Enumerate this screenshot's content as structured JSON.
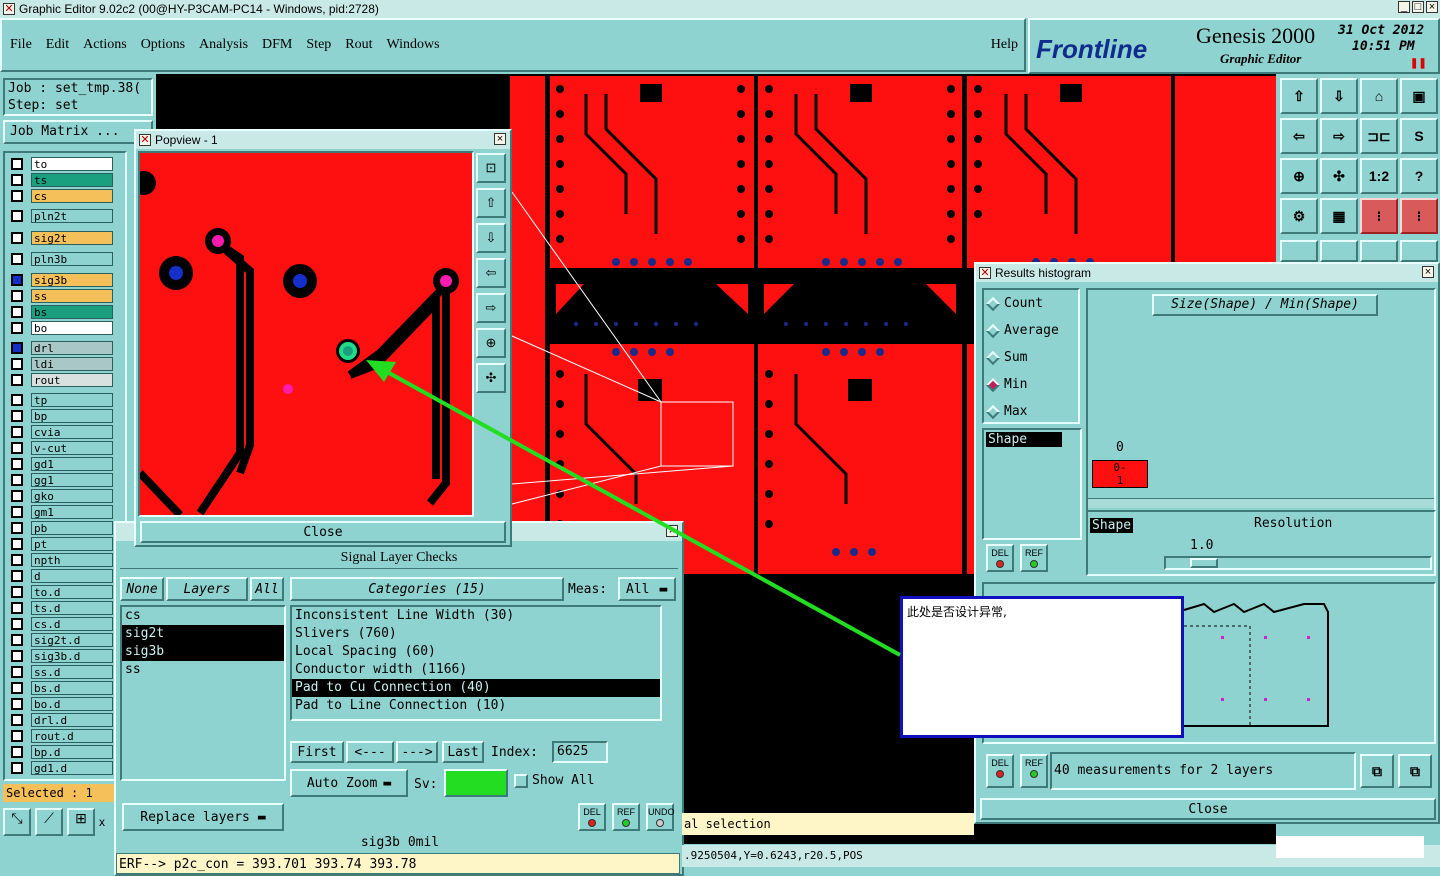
{
  "window": {
    "title": "Graphic Editor 9.02c2 (00@HY-P3CAM-PC14 - Windows, pid:2728)"
  },
  "menu": [
    "File",
    "Edit",
    "Actions",
    "Options",
    "Analysis",
    "DFM",
    "Step",
    "Rout",
    "Windows"
  ],
  "help": "Help",
  "brand": {
    "logo": "Frontline",
    "product": "Genesis 2000",
    "sub": "Graphic Editor",
    "date": "31 Oct 2012",
    "time": "10:51 PM"
  },
  "job": {
    "job": "Job : set_tmp.38(",
    "step": "Step: set",
    "matrix_btn": "Job Matrix ..."
  },
  "layers": [
    {
      "name": "to",
      "color": "#ffffff"
    },
    {
      "name": "ts",
      "color": "#1aa07f"
    },
    {
      "name": "cs",
      "color": "#f5c05a"
    },
    {
      "name": "pln2t",
      "color": "#8fd3d0"
    },
    {
      "name": "sig2t",
      "color": "#f5c05a"
    },
    {
      "name": "pln3b",
      "color": "#8fd3d0"
    },
    {
      "name": "sig3b",
      "color": "#f5c05a"
    },
    {
      "name": "ss",
      "color": "#f5c05a"
    },
    {
      "name": "bs",
      "color": "#1aa07f"
    },
    {
      "name": "bo",
      "color": "#ffffff"
    },
    {
      "name": "drl",
      "color": "#a9c7c6"
    },
    {
      "name": "ldi",
      "color": "#a9c7c6"
    },
    {
      "name": "rout",
      "color": "#d8e0e0"
    },
    {
      "name": "tp",
      "color": "#8fd3d0"
    },
    {
      "name": "bp",
      "color": "#8fd3d0"
    },
    {
      "name": "cvia",
      "color": "#8fd3d0"
    },
    {
      "name": "v-cut",
      "color": "#8fd3d0"
    },
    {
      "name": "gd1",
      "color": "#8fd3d0"
    },
    {
      "name": "gg1",
      "color": "#8fd3d0"
    },
    {
      "name": "gko",
      "color": "#8fd3d0"
    },
    {
      "name": "gm1",
      "color": "#8fd3d0"
    },
    {
      "name": "pb",
      "color": "#8fd3d0"
    },
    {
      "name": "pt",
      "color": "#8fd3d0"
    },
    {
      "name": "npth",
      "color": "#8fd3d0"
    },
    {
      "name": "d",
      "color": "#8fd3d0"
    },
    {
      "name": "to.d",
      "color": "#8fd3d0"
    },
    {
      "name": "ts.d",
      "color": "#8fd3d0"
    },
    {
      "name": "cs.d",
      "color": "#8fd3d0"
    },
    {
      "name": "sig2t.d",
      "color": "#8fd3d0"
    },
    {
      "name": "sig3b.d",
      "color": "#8fd3d0"
    },
    {
      "name": "ss.d",
      "color": "#8fd3d0"
    },
    {
      "name": "bs.d",
      "color": "#8fd3d0"
    },
    {
      "name": "bo.d",
      "color": "#8fd3d0"
    },
    {
      "name": "drl.d",
      "color": "#8fd3d0"
    },
    {
      "name": "rout.d",
      "color": "#8fd3d0"
    },
    {
      "name": "bp.d",
      "color": "#8fd3d0"
    },
    {
      "name": "gd1.d",
      "color": "#8fd3d0"
    }
  ],
  "selected": "Selected : 1",
  "popview": {
    "title": "Popview - 1",
    "close": "Close"
  },
  "checks": {
    "title": "Signal Layer Checks",
    "none": "None",
    "layers_lbl": "Layers",
    "all": "All",
    "categories_lbl": "Categories (15)",
    "meas_lbl": "Meas:",
    "meas_val": "All",
    "layer_list": [
      "cs",
      "sig2t",
      "sig3b",
      "ss"
    ],
    "categories": [
      "Inconsistent Line Width (30)",
      "Slivers (760)",
      "Local Spacing (60)",
      "Conductor width (1166)",
      "Pad to Cu Connection (40)",
      "Pad to Line Connection (10)"
    ],
    "first": "First",
    "prev": "<---",
    "next": "--->",
    "last": "Last",
    "index_lbl": "Index:",
    "index_val": "6625",
    "autozoom": "Auto Zoom",
    "sv": "Sv:",
    "show_all": "Show All",
    "replace": "Replace layers",
    "del": "DEL",
    "ref": "REF",
    "undo": "UNDO"
  },
  "status": {
    "layer_info": "sig3b 0mil",
    "erf": "ERF--> p2c_con = 393.701 393.74 393.78",
    "selection": "al selection",
    "coords": ".9250504,Y=0.6243,r20.5,POS"
  },
  "histogram": {
    "title": "Results histogram",
    "options": [
      "Count",
      "Average",
      "Sum",
      "Min",
      "Max"
    ],
    "formula": "Size(Shape) / Min(Shape)",
    "shape": "Shape",
    "zero": "0",
    "bar_label_top": "0-",
    "bar_label_bot": "1",
    "resolution": "Resolution",
    "res_val": "1.0",
    "measurements": "40 measurements for 2 layers",
    "close": "Close",
    "del": "DEL",
    "ref": "REF"
  },
  "note": {
    "text": "此处是否设计异常,"
  },
  "colors": {
    "board_red": "#ff1010",
    "panel": "#8fd3d0",
    "arrow": "#22dd22"
  }
}
